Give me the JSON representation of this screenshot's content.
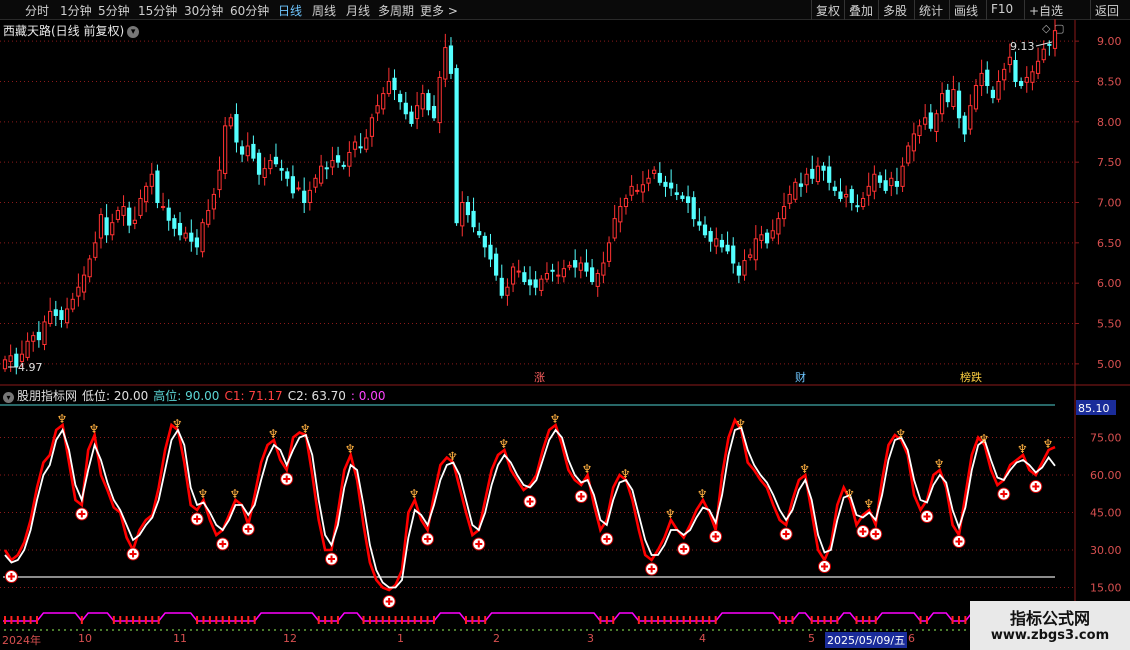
{
  "toolbar": {
    "tabs": [
      "分时",
      "1分钟",
      "5分钟",
      "15分钟",
      "30分钟",
      "60分钟",
      "日线",
      "周线",
      "月线",
      "多周期",
      "更多 >"
    ],
    "active_tab": "日线",
    "right_buttons": [
      "复权",
      "叠加",
      "多股",
      "统计",
      "画线",
      "F10",
      "+自选",
      "返回"
    ],
    "side_icons": [
      "◇",
      "▢"
    ]
  },
  "stock": {
    "title": "西藏天路(日线 前复权)",
    "high_label": "9.13",
    "low_label": "4.97"
  },
  "price_axis": [
    "9.00",
    "8.50",
    "8.00",
    "7.50",
    "7.00",
    "6.50",
    "6.00",
    "5.50",
    "5.00"
  ],
  "events": [
    "涨",
    "财",
    "榜跌"
  ],
  "indicator": {
    "name": "股朋指标网",
    "low_label": "低位: 20.00",
    "high_label": "高位: 90.00",
    "c1_label": "C1: 71.17",
    "c2_label": "C2: 63.70",
    "c3_label": ": 0.00",
    "value_box": "85.10",
    "axis": [
      "75.00",
      "60.00",
      "45.00",
      "30.00",
      "15.00"
    ]
  },
  "x_axis": [
    "2024年",
    "10",
    "11",
    "12",
    "1",
    "2",
    "3",
    "4",
    "5",
    "2025/05/09/五",
    "6"
  ],
  "watermark": {
    "line1": "指标公式网",
    "line2": "www.zbgs3.com"
  },
  "colors": {
    "up": "#ff3232",
    "down": "#54ffff",
    "grid": "#8b1a1a",
    "axis_text": "#d85050",
    "c1": "#ff0000",
    "c2": "#ffffff",
    "magenta": "#ff00ff",
    "indicator_label": "#ff4040"
  },
  "chart_data": [
    {
      "type": "candlestick",
      "title": "西藏天路(日线 前复权)",
      "ylim": [
        4.8,
        9.2
      ],
      "y_ticks": [
        9.0,
        8.5,
        8.0,
        7.5,
        7.0,
        6.5,
        6.0,
        5.5,
        5.0
      ],
      "x_ticks": [
        "2024年",
        "10",
        "11",
        "12",
        "1",
        "2",
        "3",
        "4",
        "5",
        "2025/05/09/五",
        "6"
      ],
      "close": [
        5.05,
        5.1,
        4.97,
        5.12,
        5.28,
        5.35,
        5.3,
        5.52,
        5.65,
        5.6,
        5.55,
        5.68,
        5.8,
        5.95,
        6.1,
        6.3,
        6.5,
        6.85,
        6.6,
        6.75,
        6.9,
        6.95,
        6.72,
        6.78,
        7.05,
        7.2,
        7.35,
        7.0,
        6.95,
        6.78,
        6.68,
        6.6,
        6.62,
        6.52,
        6.45,
        6.75,
        6.9,
        7.1,
        7.4,
        7.95,
        8.05,
        7.75,
        7.6,
        7.7,
        7.55,
        7.35,
        7.42,
        7.52,
        7.48,
        7.4,
        7.3,
        7.12,
        7.18,
        7.0,
        7.15,
        7.3,
        7.45,
        7.42,
        7.52,
        7.5,
        7.45,
        7.62,
        7.75,
        7.68,
        7.8,
        8.05,
        8.2,
        8.35,
        8.5,
        8.4,
        8.25,
        8.1,
        7.98,
        8.2,
        8.35,
        8.15,
        8.05,
        8.55,
        8.92,
        8.6,
        6.75,
        7.0,
        6.85,
        6.7,
        6.6,
        6.45,
        6.3,
        6.1,
        5.85,
        5.95,
        6.2,
        6.15,
        6.02,
        5.98,
        5.95,
        6.05,
        6.12,
        6.15,
        6.1,
        6.18,
        6.22,
        6.2,
        6.25,
        6.15,
        6.02,
        6.12,
        6.25,
        6.5,
        6.8,
        6.95,
        7.05,
        7.2,
        7.15,
        7.22,
        7.3,
        7.4,
        7.25,
        7.2,
        7.18,
        7.1,
        7.05,
        7.0,
        6.8,
        6.72,
        6.6,
        6.52,
        6.55,
        6.45,
        6.4,
        6.25,
        6.1,
        6.28,
        6.35,
        6.55,
        6.6,
        6.5,
        6.65,
        6.8,
        6.95,
        7.1,
        7.25,
        7.2,
        7.35,
        7.3,
        7.45,
        7.4,
        7.25,
        7.15,
        7.05,
        7.1,
        7.0,
        6.95,
        7.05,
        7.2,
        7.35,
        7.25,
        7.15,
        7.3,
        7.2,
        7.45,
        7.7,
        7.85,
        7.95,
        8.05,
        7.92,
        8.1,
        8.35,
        8.25,
        8.4,
        8.05,
        7.85,
        8.2,
        8.45,
        8.6,
        8.45,
        8.3,
        8.5,
        8.65,
        8.8,
        8.5,
        8.45,
        8.55,
        8.62,
        8.75,
        8.9,
        8.95,
        9.13
      ]
    },
    {
      "type": "line",
      "title": "股朋指标网",
      "ylim": [
        10,
        90
      ],
      "y_ticks": [
        75,
        60,
        45,
        30,
        15
      ],
      "series": [
        {
          "name": "C1",
          "last": 71.17
        },
        {
          "name": "C2",
          "last": 63.7
        }
      ],
      "reference_lines": [
        {
          "label": "低位",
          "value": 20
        },
        {
          "label": "高位",
          "value": 90
        }
      ],
      "c1": [
        30,
        26,
        28,
        33,
        42,
        55,
        65,
        68,
        78,
        80,
        65,
        50,
        48,
        70,
        76,
        60,
        54,
        47,
        45,
        35,
        30,
        38,
        42,
        44,
        55,
        70,
        80,
        78,
        65,
        48,
        46,
        50,
        42,
        36,
        38,
        44,
        50,
        48,
        40,
        52,
        65,
        72,
        74,
        66,
        62,
        75,
        77,
        76,
        60,
        42,
        30,
        30,
        45,
        62,
        68,
        58,
        40,
        25,
        18,
        15,
        14,
        16,
        22,
        45,
        50,
        42,
        38,
        52,
        64,
        67,
        65,
        55,
        45,
        36,
        38,
        50,
        62,
        68,
        70,
        62,
        58,
        54,
        56,
        60,
        70,
        78,
        80,
        72,
        62,
        58,
        56,
        60,
        48,
        38,
        42,
        55,
        60,
        58,
        50,
        38,
        28,
        26,
        30,
        35,
        42,
        38,
        35,
        40,
        46,
        50,
        45,
        38,
        60,
        75,
        82,
        78,
        65,
        62,
        58,
        55,
        48,
        42,
        40,
        50,
        58,
        60,
        45,
        30,
        26,
        32,
        48,
        55,
        50,
        40,
        44,
        46,
        40,
        58,
        72,
        76,
        74,
        68,
        52,
        46,
        50,
        60,
        62,
        55,
        40,
        36,
        52,
        68,
        75,
        72,
        62,
        56,
        58,
        64,
        66,
        68,
        62,
        60,
        65,
        70,
        71.17
      ],
      "c2": [
        28,
        25,
        26,
        30,
        38,
        50,
        60,
        64,
        74,
        78,
        70,
        56,
        50,
        62,
        72,
        66,
        57,
        50,
        46,
        40,
        34,
        36,
        40,
        43,
        50,
        62,
        74,
        78,
        72,
        55,
        48,
        49,
        45,
        40,
        38,
        42,
        48,
        48,
        44,
        48,
        58,
        67,
        72,
        70,
        64,
        70,
        75,
        76,
        68,
        50,
        36,
        32,
        40,
        55,
        64,
        62,
        48,
        32,
        22,
        17,
        15,
        15,
        18,
        35,
        46,
        44,
        40,
        48,
        58,
        64,
        65,
        60,
        50,
        40,
        38,
        45,
        56,
        64,
        68,
        65,
        60,
        56,
        55,
        58,
        66,
        74,
        78,
        75,
        66,
        60,
        57,
        58,
        52,
        42,
        40,
        50,
        57,
        58,
        54,
        44,
        34,
        28,
        28,
        32,
        38,
        38,
        36,
        38,
        43,
        47,
        46,
        41,
        52,
        68,
        78,
        79,
        70,
        64,
        60,
        57,
        52,
        46,
        42,
        46,
        54,
        58,
        50,
        36,
        29,
        30,
        42,
        51,
        52,
        44,
        43,
        45,
        42,
        52,
        66,
        74,
        75,
        70,
        58,
        50,
        49,
        56,
        60,
        57,
        46,
        39,
        47,
        62,
        72,
        74,
        66,
        59,
        58,
        62,
        65,
        66,
        64,
        61,
        63,
        67,
        63.7
      ]
    }
  ]
}
